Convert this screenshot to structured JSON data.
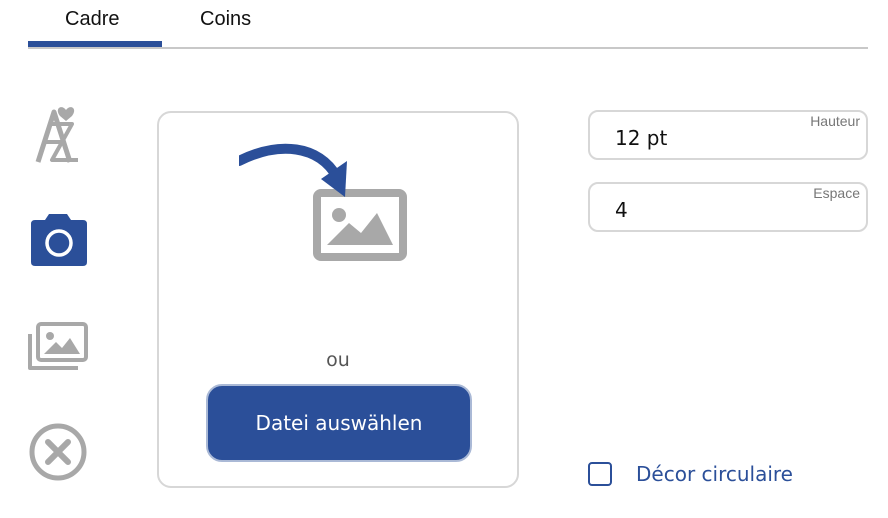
{
  "tabs": [
    {
      "label": "Cadre",
      "active": true
    },
    {
      "label": "Coins",
      "active": false
    }
  ],
  "tools": [
    {
      "icon": "text-icon"
    },
    {
      "icon": "camera-icon",
      "active": true
    },
    {
      "icon": "gallery-icon"
    },
    {
      "icon": "remove-icon"
    }
  ],
  "upload": {
    "or_text": "ou",
    "choose_file_label": "Datei auswählen",
    "illustration_icon": "image-upload-icon"
  },
  "fields": {
    "height": {
      "label": "Hauteur",
      "value": "12 pt"
    },
    "spacing": {
      "label": "Espace",
      "value": "4"
    }
  },
  "circular_decor": {
    "label": "Décor circulaire",
    "checked": false
  },
  "colors": {
    "accent": "#2b4f99",
    "icon_gray": "#a8a8a8",
    "border": "#d7d7d7"
  }
}
